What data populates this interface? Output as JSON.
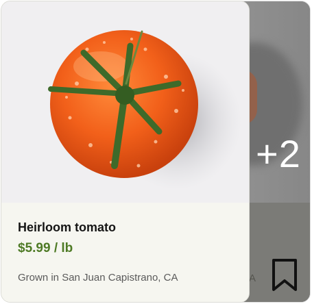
{
  "product": {
    "name": "Heirloom tomato",
    "price": "$5.99 / lb",
    "origin": "Grown in San Juan Capistrano, CA",
    "image_icon": "tomato-photo"
  },
  "stack": {
    "more_count": "+2",
    "partial_origin": "A",
    "bookmark_icon": "bookmark-icon"
  },
  "colors": {
    "price": "#4e7a25",
    "card_bg": "#f6f6f0",
    "photo_bg": "#f0eff1"
  }
}
